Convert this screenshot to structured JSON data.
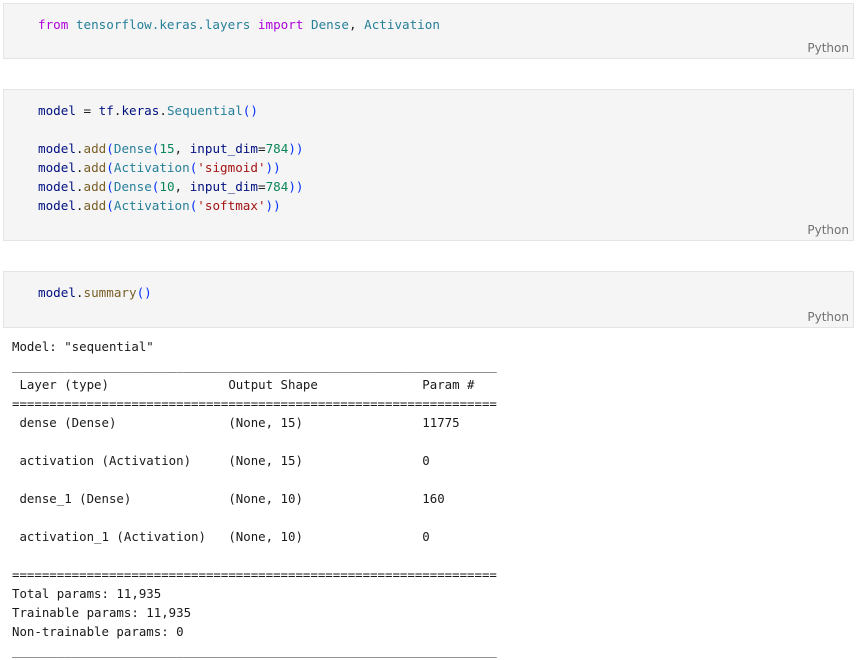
{
  "cells": [
    {
      "language": "Python",
      "code": {
        "l1": {
          "kw_from": "from",
          "module": "tensorflow.keras.layers",
          "kw_import": "import",
          "name1": "Dense",
          "sep": ", ",
          "name2": "Activation"
        }
      }
    },
    {
      "language": "Python",
      "code": {
        "l1": {
          "var": "model",
          "eq": " = ",
          "ns1": "tf",
          "dot1": ".",
          "ns2": "keras",
          "dot2": ".",
          "cls": "Sequential",
          "parens": "()"
        },
        "l2": {
          "obj": "model",
          "dot": ".",
          "fn": "add",
          "po": "(",
          "cls": "Dense",
          "po2": "(",
          "num1": "15",
          "sep": ", ",
          "kw": "input_dim",
          "eq": "=",
          "num2": "784",
          "pc": "))"
        },
        "l3": {
          "obj": "model",
          "dot": ".",
          "fn": "add",
          "po": "(",
          "cls": "Activation",
          "po2": "(",
          "str": "'sigmoid'",
          "pc": "))"
        },
        "l4": {
          "obj": "model",
          "dot": ".",
          "fn": "add",
          "po": "(",
          "cls": "Dense",
          "po2": "(",
          "num1": "10",
          "sep": ", ",
          "kw": "input_dim",
          "eq": "=",
          "num2": "784",
          "pc": "))"
        },
        "l5": {
          "obj": "model",
          "dot": ".",
          "fn": "add",
          "po": "(",
          "cls": "Activation",
          "po2": "(",
          "str": "'softmax'",
          "pc": "))"
        }
      }
    },
    {
      "language": "Python",
      "code": {
        "l1": {
          "var": "model",
          "dot": ".",
          "fn": "summary",
          "parens": "()"
        }
      }
    }
  ],
  "output": "Model: \"sequential\"\n_________________________________________________________________\n Layer (type)                Output Shape              Param #   \n=================================================================\n dense (Dense)               (None, 15)                11775     \n                                                                 \n activation (Activation)     (None, 15)                0         \n                                                                 \n dense_1 (Dense)             (None, 10)                160       \n                                                                 \n activation_1 (Activation)   (None, 10)                0         \n                                                                 \n=================================================================\nTotal params: 11,935\nTrainable params: 11,935\nNon-trainable params: 0\n_________________________________________________________________"
}
